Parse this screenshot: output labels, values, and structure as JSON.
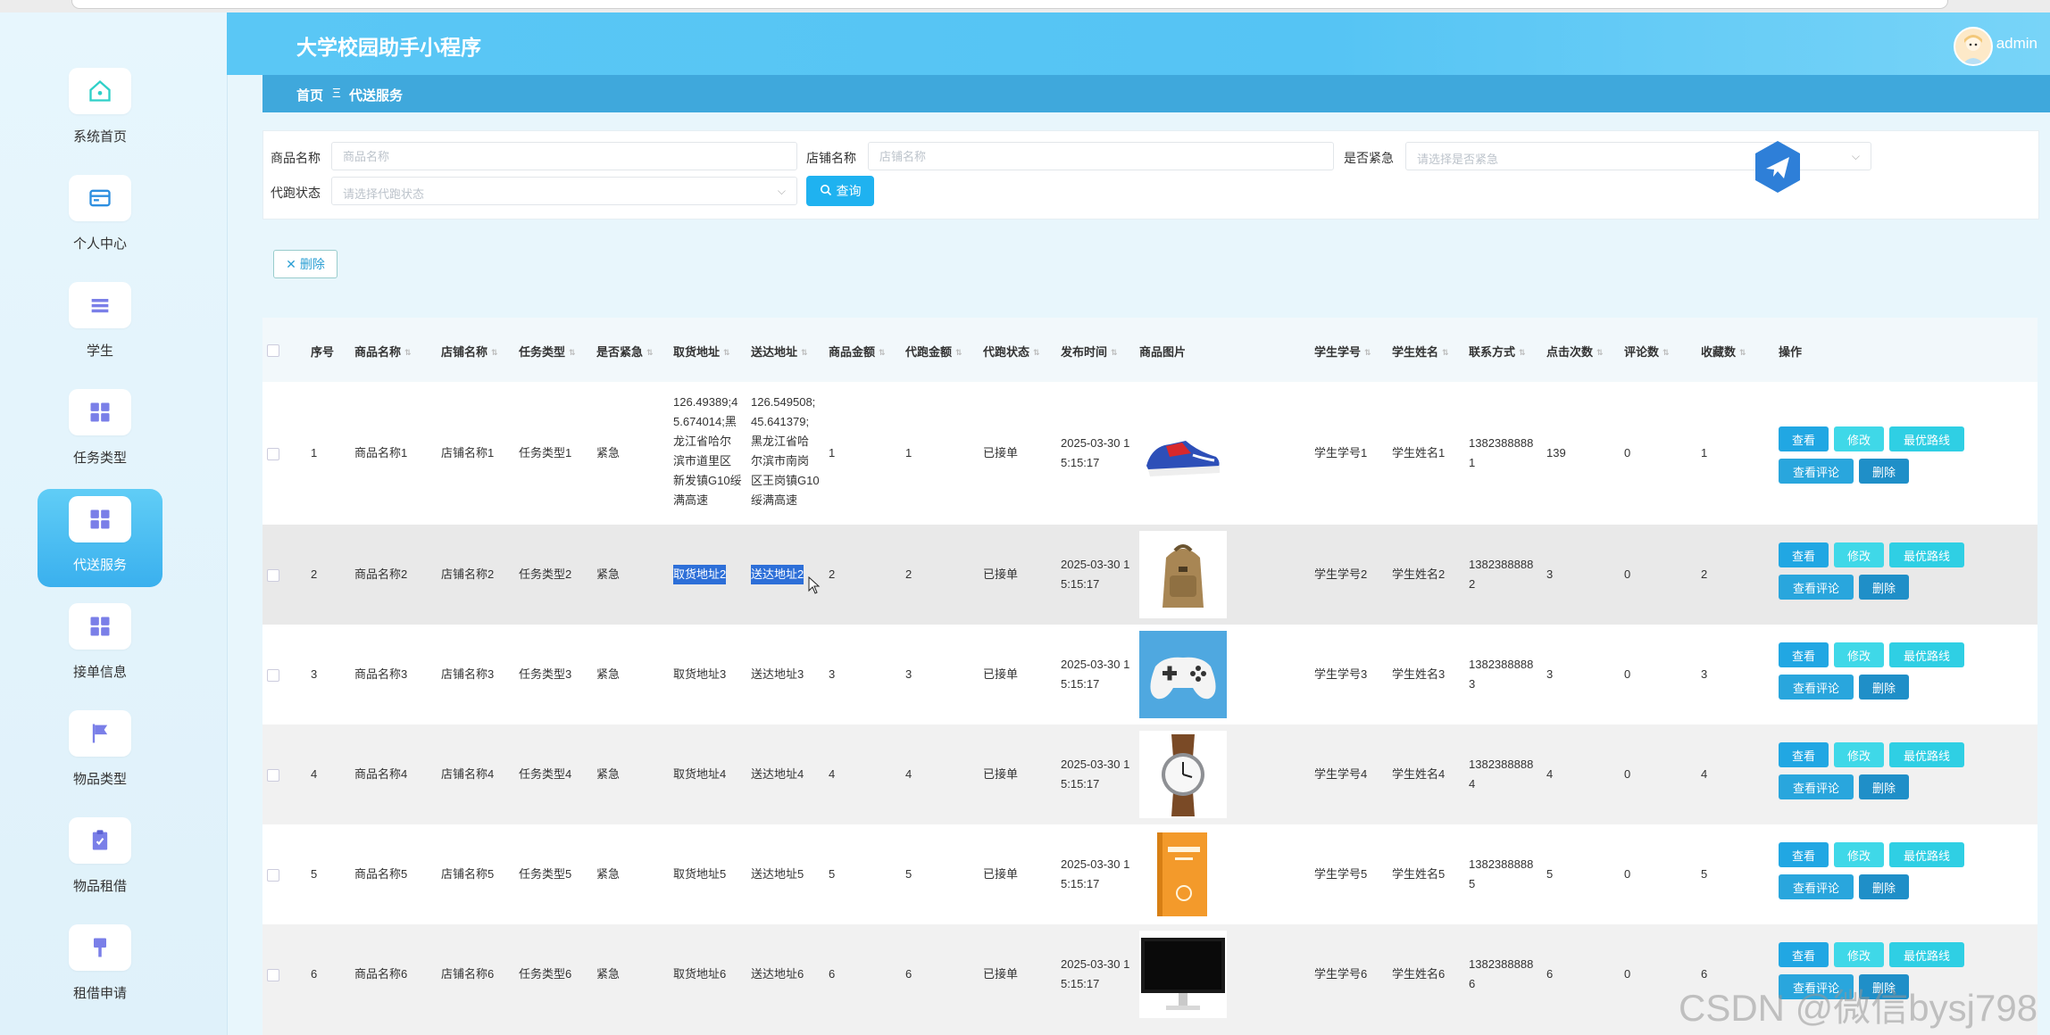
{
  "app": {
    "title": "大学校园助手小程序",
    "user": "admin"
  },
  "breadcrumb": {
    "home": "首页",
    "sep": "Ξ",
    "current": "代送服务"
  },
  "sidebar": {
    "items": [
      {
        "label": "系统首页",
        "icon": "home-icon",
        "active": false
      },
      {
        "label": "个人中心",
        "icon": "card-icon",
        "active": false
      },
      {
        "label": "学生",
        "icon": "list-icon",
        "active": false
      },
      {
        "label": "任务类型",
        "icon": "grid-icon",
        "active": false
      },
      {
        "label": "代送服务",
        "icon": "grid-icon",
        "active": true
      },
      {
        "label": "接单信息",
        "icon": "grid-icon",
        "active": false
      },
      {
        "label": "物品类型",
        "icon": "flag-icon",
        "active": false
      },
      {
        "label": "物品租借",
        "icon": "clipboard-icon",
        "active": false
      },
      {
        "label": "租借申请",
        "icon": "brush-icon",
        "active": false
      }
    ]
  },
  "search": {
    "product_label": "商品名称",
    "product_placeholder": "商品名称",
    "shop_label": "店铺名称",
    "shop_placeholder": "店铺名称",
    "urgent_label": "是否紧急",
    "urgent_placeholder": "请选择是否紧急",
    "status_label": "代跑状态",
    "status_placeholder": "请选择代跑状态",
    "query_button": "查询"
  },
  "toolbar": {
    "delete_button": "删除"
  },
  "table": {
    "columns": [
      "序号",
      "商品名称",
      "店铺名称",
      "任务类型",
      "是否紧急",
      "取货地址",
      "送达地址",
      "商品金额",
      "代跑金额",
      "代跑状态",
      "发布时间",
      "商品图片",
      "学生学号",
      "学生姓名",
      "联系方式",
      "点击次数",
      "评论数",
      "收藏数",
      "操作"
    ],
    "actions": {
      "view": "查看",
      "edit": "修改",
      "route": "最优路线",
      "comment": "查看评论",
      "delete": "删除"
    },
    "rows": [
      {
        "idx": "1",
        "product": "商品名称1",
        "shop": "店铺名称1",
        "task": "任务类型1",
        "urgent": "紧急",
        "pickup": [
          "126.49389;4",
          "5.674014;黑",
          "龙江省哈尔",
          "滨市道里区",
          "新发镇G10绥",
          "满高速"
        ],
        "deliver": [
          "126.549508;",
          "45.641379;",
          "黑龙江省哈",
          "尔滨市南岗",
          "区王岗镇G10",
          "绥满高速"
        ],
        "amount": "1",
        "fee": "1",
        "status": "已接单",
        "time": [
          "2025-03-30 1",
          "5:15:17"
        ],
        "image": "shoe-image",
        "sid": "学生学号1",
        "sname": "学生姓名1",
        "phone": [
          "1382388888",
          "1"
        ],
        "clicks": "139",
        "comments": "0",
        "favs": "1"
      },
      {
        "idx": "2",
        "product": "商品名称2",
        "shop": "店铺名称2",
        "task": "任务类型2",
        "urgent": "紧急",
        "pickup": [
          "取货地址2"
        ],
        "deliver": [
          "送达地址2"
        ],
        "amount": "2",
        "fee": "2",
        "status": "已接单",
        "time": [
          "2025-03-30 1",
          "5:15:17"
        ],
        "image": "backpack-image",
        "sid": "学生学号2",
        "sname": "学生姓名2",
        "phone": [
          "1382388888",
          "2"
        ],
        "clicks": "3",
        "comments": "0",
        "favs": "2"
      },
      {
        "idx": "3",
        "product": "商品名称3",
        "shop": "店铺名称3",
        "task": "任务类型3",
        "urgent": "紧急",
        "pickup": [
          "取货地址3"
        ],
        "deliver": [
          "送达地址3"
        ],
        "amount": "3",
        "fee": "3",
        "status": "已接单",
        "time": [
          "2025-03-30 1",
          "5:15:17"
        ],
        "image": "gamepad-image",
        "sid": "学生学号3",
        "sname": "学生姓名3",
        "phone": [
          "1382388888",
          "3"
        ],
        "clicks": "3",
        "comments": "0",
        "favs": "3"
      },
      {
        "idx": "4",
        "product": "商品名称4",
        "shop": "店铺名称4",
        "task": "任务类型4",
        "urgent": "紧急",
        "pickup": [
          "取货地址4"
        ],
        "deliver": [
          "送达地址4"
        ],
        "amount": "4",
        "fee": "4",
        "status": "已接单",
        "time": [
          "2025-03-30 1",
          "5:15:17"
        ],
        "image": "watch-image",
        "sid": "学生学号4",
        "sname": "学生姓名4",
        "phone": [
          "1382388888",
          "4"
        ],
        "clicks": "4",
        "comments": "0",
        "favs": "4"
      },
      {
        "idx": "5",
        "product": "商品名称5",
        "shop": "店铺名称5",
        "task": "任务类型5",
        "urgent": "紧急",
        "pickup": [
          "取货地址5"
        ],
        "deliver": [
          "送达地址5"
        ],
        "amount": "5",
        "fee": "5",
        "status": "已接单",
        "time": [
          "2025-03-30 1",
          "5:15:17"
        ],
        "image": "book-image",
        "sid": "学生学号5",
        "sname": "学生姓名5",
        "phone": [
          "1382388888",
          "5"
        ],
        "clicks": "5",
        "comments": "0",
        "favs": "5"
      },
      {
        "idx": "6",
        "product": "商品名称6",
        "shop": "店铺名称6",
        "task": "任务类型6",
        "urgent": "紧急",
        "pickup": [
          "取货地址6"
        ],
        "deliver": [
          "送达地址6"
        ],
        "amount": "6",
        "fee": "6",
        "status": "已接单",
        "time": [
          "2025-03-30 1",
          "5:15:17"
        ],
        "image": "monitor-image",
        "sid": "学生学号6",
        "sname": "学生姓名6",
        "phone": [
          "1382388888",
          "6"
        ],
        "clicks": "6",
        "comments": "0",
        "favs": "6"
      }
    ]
  },
  "watermark": "CSDN @微信bysj798"
}
